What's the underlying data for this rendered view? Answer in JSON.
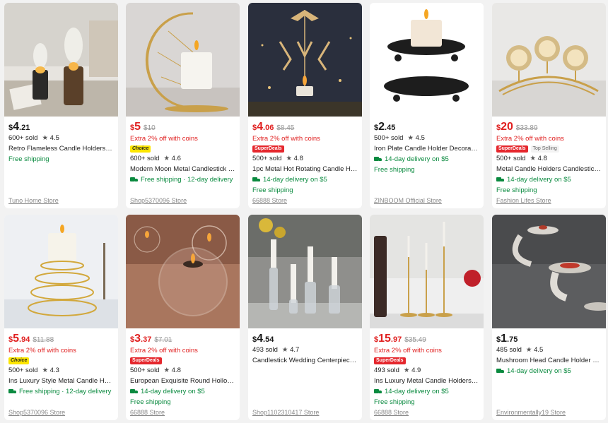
{
  "products": [
    {
      "currency": "$",
      "price_int": "4",
      "price_dec": ".21",
      "price_red": false,
      "original": "",
      "promo": "",
      "badges": [],
      "sold": "600+ sold",
      "rating": "4.5",
      "title": "Retro Flameless Candle Holders Ca...",
      "shipping": [
        {
          "truck": false,
          "text": "Free shipping"
        }
      ],
      "store": "Tuno Home Store",
      "icon": "oil-lamp-candle-image"
    },
    {
      "currency": "$",
      "price_int": "5",
      "price_dec": "",
      "price_red": true,
      "original": "$10",
      "promo": "Extra 2% off with coins",
      "badges": [
        {
          "type": "choice",
          "label": "Choice"
        }
      ],
      "sold": "600+ sold",
      "rating": "4.6",
      "title": "Modern Moon Metal Candlestick R...",
      "shipping": [
        {
          "truck": true,
          "text": "Free shipping · 12-day delivery"
        }
      ],
      "store": "Shop5370096 Store",
      "icon": "moon-candle-holder-image"
    },
    {
      "currency": "$",
      "price_int": "4",
      "price_dec": ".06",
      "price_red": true,
      "original": "$8.45",
      "promo": "Extra 2% off with coins",
      "badges": [
        {
          "type": "superdeals",
          "label": "SuperDeals"
        }
      ],
      "sold": "500+ sold",
      "rating": "4.8",
      "title": "1pc Metal Hot Rotating Candle Hol...",
      "shipping": [
        {
          "truck": true,
          "text": "14-day delivery on $5"
        },
        {
          "truck": false,
          "text": "Free shipping"
        }
      ],
      "store": "66888 Store",
      "icon": "rotating-fairy-candle-image"
    },
    {
      "currency": "$",
      "price_int": "2",
      "price_dec": ".45",
      "price_red": false,
      "original": "",
      "promo": "",
      "badges": [],
      "sold": "500+ sold",
      "rating": "4.5",
      "title": "Iron Plate Candle Holder Decorativ...",
      "shipping": [
        {
          "truck": true,
          "text": "14-day delivery on $5"
        },
        {
          "truck": false,
          "text": "Free shipping"
        }
      ],
      "store": "ZINBOOM Official Store",
      "icon": "iron-plate-candle-image"
    },
    {
      "currency": "$",
      "price_int": "20",
      "price_dec": "",
      "price_red": true,
      "original": "$33.89",
      "promo": "Extra 2% off with coins",
      "badges": [
        {
          "type": "superdeals",
          "label": "SuperDeals"
        },
        {
          "type": "topsell",
          "label": "Top Selling"
        }
      ],
      "sold": "500+ sold",
      "rating": "4.8",
      "title": "Metal Candle Holders Candlestick C...",
      "shipping": [
        {
          "truck": true,
          "text": "14-day delivery on $5"
        },
        {
          "truck": false,
          "text": "Free shipping"
        }
      ],
      "store": "Fashion Lifes Store",
      "icon": "crystal-candle-holders-image"
    },
    {
      "currency": "$",
      "price_int": "5",
      "price_dec": ".94",
      "price_red": true,
      "original": "$11.88",
      "promo": "Extra 2% off with coins",
      "badges": [
        {
          "type": "choice",
          "label": "Choice"
        }
      ],
      "sold": "500+ sold",
      "rating": "4.3",
      "title": "Ins Luxury Style Metal Candle Hold...",
      "shipping": [
        {
          "truck": true,
          "text": "Free shipping · 12-day delivery"
        }
      ],
      "store": "Shop5370096 Store",
      "icon": "spiral-candle-holder-image"
    },
    {
      "currency": "$",
      "price_int": "3",
      "price_dec": ".37",
      "price_red": true,
      "original": "$7.01",
      "promo": "Extra 2% off with coins",
      "badges": [
        {
          "type": "superdeals",
          "label": "SuperDeals"
        }
      ],
      "sold": "500+ sold",
      "rating": "4.8",
      "title": "European Exquisite Round Hollow ...",
      "shipping": [
        {
          "truck": true,
          "text": "14-day delivery on $5"
        },
        {
          "truck": false,
          "text": "Free shipping"
        }
      ],
      "store": "66888 Store",
      "icon": "glass-globe-candle-image"
    },
    {
      "currency": "$",
      "price_int": "4",
      "price_dec": ".54",
      "price_red": false,
      "original": "",
      "promo": "",
      "badges": [],
      "sold": "493 sold",
      "rating": "4.7",
      "title": "Candlestick Wedding Centerpiece C...",
      "shipping": [],
      "store": "Shop1102310417 Store",
      "icon": "glass-candlesticks-image"
    },
    {
      "currency": "$",
      "price_int": "15",
      "price_dec": ".97",
      "price_red": true,
      "original": "$35.49",
      "promo": "Extra 2% off with coins",
      "badges": [
        {
          "type": "superdeals",
          "label": "SuperDeals"
        }
      ],
      "sold": "493 sold",
      "rating": "4.9",
      "title": "Ins Luxury Metal Candle Holders C...",
      "shipping": [
        {
          "truck": true,
          "text": "14-day delivery on $5"
        },
        {
          "truck": false,
          "text": "Free shipping"
        }
      ],
      "store": "66888 Store",
      "icon": "gold-taper-holders-image"
    },
    {
      "currency": "$",
      "price_int": "1",
      "price_dec": ".75",
      "price_red": false,
      "original": "",
      "promo": "",
      "badges": [],
      "sold": "485 sold",
      "rating": "4.5",
      "title": "Mushroom Head Candle Holder W...",
      "shipping": [
        {
          "truck": true,
          "text": "14-day delivery on $5"
        }
      ],
      "store": "Environmentally19 Store",
      "icon": "mushroom-hand-holder-image"
    }
  ]
}
